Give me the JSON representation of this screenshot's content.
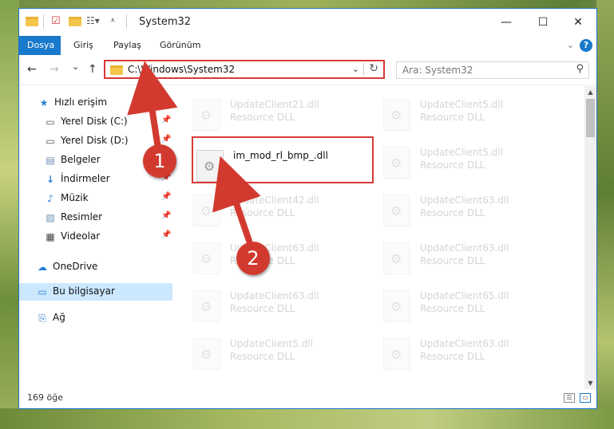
{
  "window": {
    "title": "System32"
  },
  "ribbon": {
    "tabs": [
      "Dosya",
      "Giriş",
      "Paylaş",
      "Görünüm"
    ],
    "help": "?"
  },
  "nav": {
    "back": "←",
    "forward": "→",
    "recent": "⌄",
    "up": "↑",
    "address": "C:\\Windows\\System32",
    "search_placeholder": "Ara: System32"
  },
  "sidebar": {
    "items": [
      {
        "label": "Hızlı erişim",
        "icon": "star-icon"
      },
      {
        "label": "Yerel Disk (C:)",
        "icon": "drive-icon"
      },
      {
        "label": "Yerel Disk (D:)",
        "icon": "drive-icon"
      },
      {
        "label": "Belgeler",
        "icon": "documents-icon"
      },
      {
        "label": "İndirmeler",
        "icon": "download-icon"
      },
      {
        "label": "Müzik",
        "icon": "music-icon"
      },
      {
        "label": "Resimler",
        "icon": "pictures-icon"
      },
      {
        "label": "Videolar",
        "icon": "video-icon"
      },
      {
        "label": "OneDrive",
        "icon": "cloud-icon"
      },
      {
        "label": "Bu bilgisayar",
        "icon": "computer-icon"
      },
      {
        "label": "Ağ",
        "icon": "network-icon"
      }
    ]
  },
  "files": {
    "left": [
      {
        "name": "UpdateClient21.dll",
        "type": "Resource DLL"
      },
      {
        "name": "im_mod_rl_bmp_.dll",
        "type": ""
      },
      {
        "name": "UpdateClient42.dll",
        "type": "Resource DLL"
      },
      {
        "name": "UpdateClient63.dll",
        "type": "Resource DLL"
      },
      {
        "name": "UpdateClient63.dll",
        "type": "Resource DLL"
      },
      {
        "name": "UpdateClient5.dll",
        "type": "Resource DLL"
      }
    ],
    "right": [
      {
        "name": "UpdateClient5.dll",
        "type": "Resource DLL"
      },
      {
        "name": "UpdateClient5.dll",
        "type": "Resource DLL"
      },
      {
        "name": "UpdateClient63.dll",
        "type": "Resource DLL"
      },
      {
        "name": "UpdateClient63.dll",
        "type": "Resource DLL"
      },
      {
        "name": "UpdateClient65.dll",
        "type": "Resource DLL"
      },
      {
        "name": "UpdateClient63.dll",
        "type": "Resource DLL"
      }
    ]
  },
  "status": {
    "count": "169 öğe"
  },
  "annotations": {
    "step1": "1",
    "step2": "2",
    "color": "#d33a2f"
  }
}
